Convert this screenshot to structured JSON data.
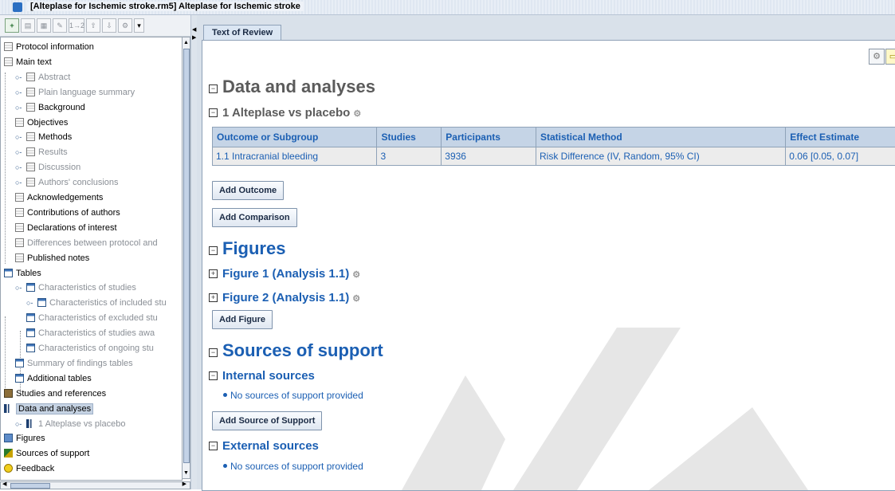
{
  "window": {
    "title": "[Alteplase for Ischemic stroke.rm5] Alteplase for Ischemic stroke"
  },
  "toolbar": {
    "buttons": [
      "add-icon",
      "doc-icon",
      "preview-icon",
      "edit-icon",
      "1→2",
      "move-up-icon",
      "move-down-icon",
      "tools-icon",
      "dropdown-icon"
    ],
    "renumber_label": "1→2"
  },
  "tree": {
    "items": [
      {
        "label": "Protocol information",
        "icon": "doc",
        "gray": false
      },
      {
        "label": "Main text",
        "icon": "doc",
        "gray": false
      },
      {
        "label": "Abstract",
        "icon": "doc",
        "gray": true
      },
      {
        "label": "Plain language summary",
        "icon": "doc",
        "gray": true
      },
      {
        "label": "Background",
        "icon": "doc",
        "gray": false
      },
      {
        "label": "Objectives",
        "icon": "doc",
        "gray": false
      },
      {
        "label": "Methods",
        "icon": "doc",
        "gray": false
      },
      {
        "label": "Results",
        "icon": "doc",
        "gray": true
      },
      {
        "label": "Discussion",
        "icon": "doc",
        "gray": true
      },
      {
        "label": "Authors' conclusions",
        "icon": "doc",
        "gray": true
      },
      {
        "label": "Acknowledgements",
        "icon": "doc",
        "gray": false
      },
      {
        "label": "Contributions of authors",
        "icon": "doc",
        "gray": false
      },
      {
        "label": "Declarations of interest",
        "icon": "doc",
        "gray": false
      },
      {
        "label": "Differences between protocol and",
        "icon": "doc",
        "gray": true
      },
      {
        "label": "Published notes",
        "icon": "doc",
        "gray": false
      },
      {
        "label": "Tables",
        "icon": "tbl",
        "gray": false
      },
      {
        "label": "Characteristics of studies",
        "icon": "tbl",
        "gray": true
      },
      {
        "label": "Characteristics of included stu",
        "icon": "tbl",
        "gray": true
      },
      {
        "label": "Characteristics of excluded stu",
        "icon": "tbl",
        "gray": true
      },
      {
        "label": "Characteristics of studies awa",
        "icon": "tbl",
        "gray": true
      },
      {
        "label": "Characteristics of ongoing stu",
        "icon": "tbl",
        "gray": true
      },
      {
        "label": "Summary of findings tables",
        "icon": "tbl",
        "gray": true
      },
      {
        "label": "Additional tables",
        "icon": "tbl",
        "gray": false
      },
      {
        "label": "Studies and references",
        "icon": "book",
        "gray": false
      },
      {
        "label": "Data and analyses",
        "icon": "data",
        "gray": false
      },
      {
        "label": "1 Alteplase vs placebo",
        "icon": "data",
        "gray": true
      },
      {
        "label": "Figures",
        "icon": "fig",
        "gray": false
      },
      {
        "label": "Sources of support",
        "icon": "support",
        "gray": false
      },
      {
        "label": "Feedback",
        "icon": "help",
        "gray": false
      }
    ]
  },
  "tabs": [
    {
      "label": "Text of Review"
    }
  ],
  "review": {
    "data_heading": "Data and analyses",
    "comparison_heading": "1 Alteplase vs placebo",
    "table": {
      "headers": [
        "Outcome or Subgroup",
        "Studies",
        "Participants",
        "Statistical Method",
        "Effect Estimate"
      ],
      "rows": [
        [
          "1.1 Intracranial bleeding",
          "3",
          "3936",
          "Risk Difference (IV, Random, 95% CI)",
          "0.06 [0.05, 0.07]"
        ]
      ]
    },
    "add_outcome": "Add Outcome",
    "add_comparison": "Add Comparison",
    "figures_heading": "Figures",
    "figure1": "Figure 1 (Analysis 1.1)",
    "figure2": "Figure 2 (Analysis 1.1)",
    "add_figure": "Add Figure",
    "support_heading": "Sources of support",
    "internal_heading": "Internal sources",
    "internal_item": "No sources of support provided",
    "add_support": "Add Source of Support",
    "external_heading": "External sources",
    "external_item": "No sources of support provided"
  },
  "colors": {
    "link": "#1b5fb3",
    "heading_gray": "#5b5b5b",
    "table_header": "#c5d4e6"
  }
}
